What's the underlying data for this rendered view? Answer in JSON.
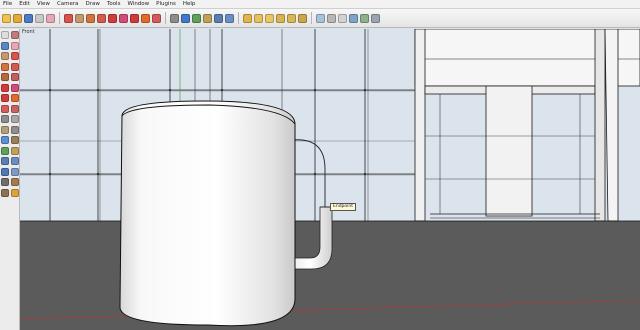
{
  "menu": [
    "File",
    "Edit",
    "View",
    "Camera",
    "Draw",
    "Tools",
    "Window",
    "Plugins",
    "Help"
  ],
  "toolbar": {
    "icons": [
      {
        "name": "new-file-icon",
        "color": "#f2c14e"
      },
      {
        "name": "open-file-icon",
        "color": "#e5a93a"
      },
      {
        "name": "save-icon",
        "color": "#4e7bc7"
      },
      {
        "name": "select-icon",
        "color": "#c9c9c9"
      },
      {
        "name": "eraser-icon",
        "color": "#e7a7b5"
      },
      {
        "name": "line-tool-icon",
        "color": "#d9534f"
      },
      {
        "name": "rectangle-tool-icon",
        "color": "#c49a6c"
      },
      {
        "name": "circle-tool-icon",
        "color": "#d4733c"
      },
      {
        "name": "arc-tool-icon",
        "color": "#d25b4c"
      },
      {
        "name": "move-tool-icon",
        "color": "#d23c3c"
      },
      {
        "name": "push-pull-tool-icon",
        "color": "#d24c7a"
      },
      {
        "name": "rotate-tool-icon",
        "color": "#cf3b3b"
      },
      {
        "name": "follow-me-tool-icon",
        "color": "#e26b2a"
      },
      {
        "name": "offset-tool-icon",
        "color": "#d65c5c"
      },
      {
        "name": "tape-measure-icon",
        "color": "#8c8c8c"
      },
      {
        "name": "paint-bucket-icon",
        "color": "#3f79c8"
      },
      {
        "name": "orbit-icon",
        "color": "#5da15d"
      },
      {
        "name": "pan-icon",
        "color": "#c0a15a"
      },
      {
        "name": "zoom-icon",
        "color": "#5b7fb5"
      },
      {
        "name": "zoom-extents-icon",
        "color": "#6b8fc5"
      },
      {
        "name": "iso-view-icon",
        "color": "#e0b54c"
      },
      {
        "name": "top-view-icon",
        "color": "#e5c15a"
      },
      {
        "name": "front-view-icon",
        "color": "#e8c865"
      },
      {
        "name": "right-view-icon",
        "color": "#d7b352"
      },
      {
        "name": "back-view-icon",
        "color": "#d9b757"
      },
      {
        "name": "left-view-icon",
        "color": "#c9a64c"
      },
      {
        "name": "x-ray-icon",
        "color": "#a7c2dc"
      },
      {
        "name": "wireframe-icon",
        "color": "#b7b7b7"
      },
      {
        "name": "hidden-line-icon",
        "color": "#d2d2d2"
      },
      {
        "name": "shaded-icon",
        "color": "#7da3c9"
      },
      {
        "name": "textured-icon",
        "color": "#8db08d"
      },
      {
        "name": "monochrome-icon",
        "color": "#9aa5b1"
      }
    ]
  },
  "sidebar": {
    "icons": [
      {
        "name": "select-arrow-icon",
        "color": "#dedede"
      },
      {
        "name": "make-component-icon",
        "color": "#c47a7a"
      },
      {
        "name": "paint-icon",
        "color": "#5a86c6"
      },
      {
        "name": "erase-icon",
        "color": "#e7a7b5"
      },
      {
        "name": "rectangle-icon",
        "color": "#c49a6c"
      },
      {
        "name": "line-icon",
        "color": "#d9534f"
      },
      {
        "name": "circle-icon",
        "color": "#d4733c"
      },
      {
        "name": "arc-icon",
        "color": "#d25b4c"
      },
      {
        "name": "polygon-icon",
        "color": "#b26b3c"
      },
      {
        "name": "freehand-icon",
        "color": "#c25e5e"
      },
      {
        "name": "move-icon",
        "color": "#d23c3c"
      },
      {
        "name": "push-pull-icon",
        "color": "#d24c7a"
      },
      {
        "name": "rotate-icon",
        "color": "#cf3b3b"
      },
      {
        "name": "follow-me-icon",
        "color": "#e26b2a"
      },
      {
        "name": "scale-icon",
        "color": "#d65c5c"
      },
      {
        "name": "offset-icon",
        "color": "#c76363"
      },
      {
        "name": "tape-measure-icon",
        "color": "#8c8c8c"
      },
      {
        "name": "dimension-icon",
        "color": "#a8a8a8"
      },
      {
        "name": "protractor-icon",
        "color": "#b3a072"
      },
      {
        "name": "text-icon",
        "color": "#8f8f8f"
      },
      {
        "name": "axes-icon",
        "color": "#5a8fd6"
      },
      {
        "name": "3d-text-icon",
        "color": "#9a7f5a"
      },
      {
        "name": "orbit-icon",
        "color": "#5da15d"
      },
      {
        "name": "pan-icon",
        "color": "#c0a15a"
      },
      {
        "name": "zoom-icon",
        "color": "#5b7fb5"
      },
      {
        "name": "zoom-window-icon",
        "color": "#6b8fc5"
      },
      {
        "name": "zoom-extents-icon",
        "color": "#4f79b8"
      },
      {
        "name": "previous-view-icon",
        "color": "#7b9bc8"
      },
      {
        "name": "position-camera-icon",
        "color": "#6e6e6e"
      },
      {
        "name": "walk-icon",
        "color": "#a57a4f"
      },
      {
        "name": "look-around-icon",
        "color": "#8b7355"
      },
      {
        "name": "section-plane-icon",
        "color": "#e0a13a"
      }
    ]
  },
  "scene": {
    "label": "Front",
    "inference_tooltip": "Endpoint",
    "colors": {
      "sky": "#dbe3ec",
      "wall_panel": "#c9d6e0",
      "ground": "#5b5b5b",
      "mug_body": "#f4f4f4",
      "mug_shadow": "#d6d6d6",
      "edge": "#1a1a1a",
      "red_axis": "#c03030",
      "green_axis": "#2e9e2e"
    }
  }
}
